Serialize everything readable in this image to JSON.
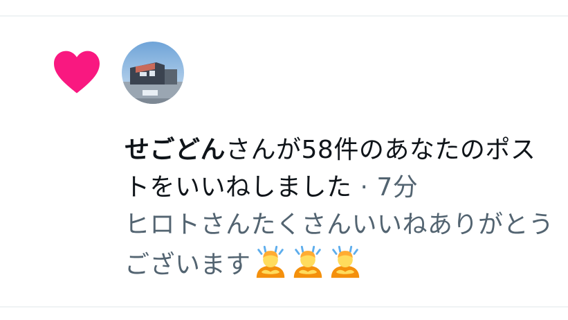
{
  "notification": {
    "user_name": "せごどん",
    "action_text": "さんが58件のあなたのポストをいいねしました",
    "separator": " · ",
    "time": "7分",
    "quoted_text": "ヒロトさんたくさんいいねありがとうございます",
    "emoji_count": 3,
    "icon": "heart-icon",
    "icon_color": "#f91880",
    "emoji_icon": "person-bowing-emoji"
  }
}
